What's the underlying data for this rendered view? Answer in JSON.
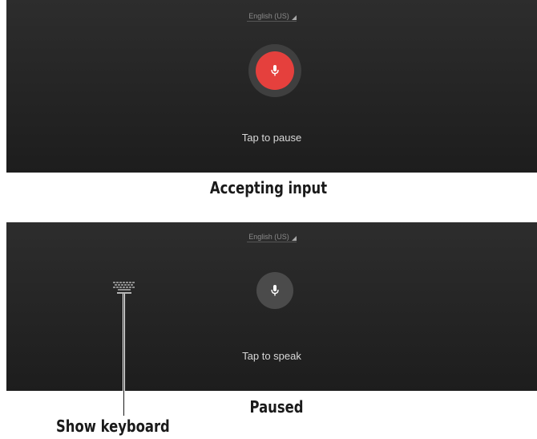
{
  "accepting_state": {
    "language": "English (US)",
    "hint": "Tap to pause",
    "caption": "Accepting input",
    "mic_color": "#e5403d",
    "icon": "microphone-icon"
  },
  "paused_state": {
    "language": "English (US)",
    "hint": "Tap to speak",
    "caption": "Paused",
    "mic_color": "#4b4b4b",
    "icon": "microphone-icon",
    "keyboard_icon": "keyboard-icon"
  },
  "callouts": {
    "show_keyboard": "Show keyboard"
  }
}
